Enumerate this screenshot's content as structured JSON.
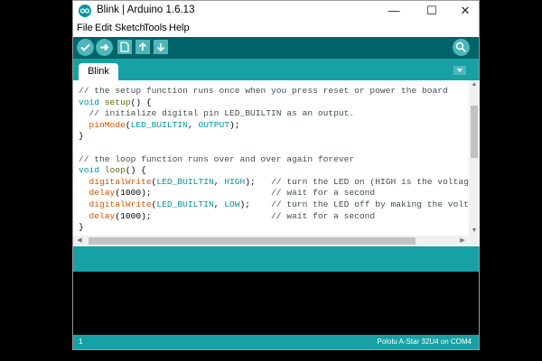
{
  "window": {
    "title": "Blink | Arduino 1.6.13",
    "controls": {
      "minimize": "—",
      "maximize": "☐",
      "close": "✕"
    }
  },
  "menu": {
    "items": [
      "File",
      "Edit",
      "Sketch",
      "Tools",
      "Help"
    ]
  },
  "toolbar": {
    "buttons": [
      "verify-icon",
      "upload-icon",
      "new-icon",
      "open-icon",
      "save-icon"
    ],
    "right": "serial-monitor-icon"
  },
  "tabs": [
    {
      "label": "Blink"
    }
  ],
  "editor": {
    "lines": [
      [
        {
          "t": "// the setup function runs once when you press reset or power the board",
          "c": "comment"
        }
      ],
      [
        {
          "t": "void",
          "c": "type"
        },
        {
          "t": " ",
          "c": "plain"
        },
        {
          "t": "setup",
          "c": "func2"
        },
        {
          "t": "() {",
          "c": "plain"
        }
      ],
      [
        {
          "t": "  // initialize digital pin LED_BUILTIN as an output.",
          "c": "comment"
        }
      ],
      [
        {
          "t": "  ",
          "c": "plain"
        },
        {
          "t": "pinMode",
          "c": "func"
        },
        {
          "t": "(",
          "c": "plain"
        },
        {
          "t": "LED_BUILTIN",
          "c": "const"
        },
        {
          "t": ", ",
          "c": "plain"
        },
        {
          "t": "OUTPUT",
          "c": "const"
        },
        {
          "t": ");",
          "c": "plain"
        }
      ],
      [
        {
          "t": "}",
          "c": "plain"
        }
      ],
      [
        {
          "t": "",
          "c": "plain"
        }
      ],
      [
        {
          "t": "// the loop function runs over and over again forever",
          "c": "comment"
        }
      ],
      [
        {
          "t": "void",
          "c": "type"
        },
        {
          "t": " ",
          "c": "plain"
        },
        {
          "t": "loop",
          "c": "func2"
        },
        {
          "t": "() {",
          "c": "plain"
        }
      ],
      [
        {
          "t": "  ",
          "c": "plain"
        },
        {
          "t": "digitalWrite",
          "c": "func"
        },
        {
          "t": "(",
          "c": "plain"
        },
        {
          "t": "LED_BUILTIN",
          "c": "const"
        },
        {
          "t": ", ",
          "c": "plain"
        },
        {
          "t": "HIGH",
          "c": "const"
        },
        {
          "t": ");   ",
          "c": "plain"
        },
        {
          "t": "// turn the LED on (HIGH is the voltage level)",
          "c": "comment"
        }
      ],
      [
        {
          "t": "  ",
          "c": "plain"
        },
        {
          "t": "delay",
          "c": "func"
        },
        {
          "t": "(1000);                       ",
          "c": "plain"
        },
        {
          "t": "// wait for a second",
          "c": "comment"
        }
      ],
      [
        {
          "t": "  ",
          "c": "plain"
        },
        {
          "t": "digitalWrite",
          "c": "func"
        },
        {
          "t": "(",
          "c": "plain"
        },
        {
          "t": "LED_BUILTIN",
          "c": "const"
        },
        {
          "t": ", ",
          "c": "plain"
        },
        {
          "t": "LOW",
          "c": "const"
        },
        {
          "t": ");    ",
          "c": "plain"
        },
        {
          "t": "// turn the LED off by making the voltage LOW",
          "c": "comment"
        }
      ],
      [
        {
          "t": "  ",
          "c": "plain"
        },
        {
          "t": "delay",
          "c": "func"
        },
        {
          "t": "(1000);                       ",
          "c": "plain"
        },
        {
          "t": "// wait for a second",
          "c": "comment"
        }
      ],
      [
        {
          "t": "}",
          "c": "plain"
        }
      ]
    ]
  },
  "syntax_colors": {
    "comment": "#434f54",
    "type": "#00979c",
    "func": "#d35400",
    "func2": "#5e6d03",
    "const": "#00979c",
    "plain": "#000000"
  },
  "footer": {
    "line": "1",
    "board": "Pololu A-Star 32U4 on COM4"
  },
  "colors": {
    "toolbar": "#006468",
    "tabbar": "#17a1a5",
    "button": "#4db7bb",
    "console": "#000000"
  }
}
